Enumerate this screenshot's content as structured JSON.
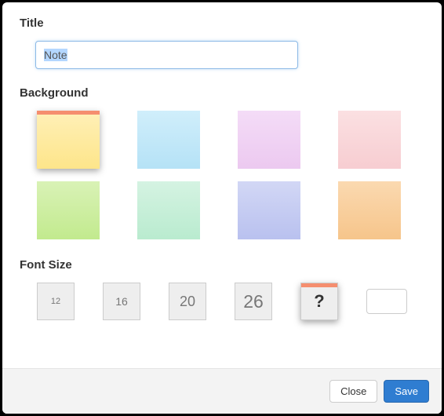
{
  "labels": {
    "title": "Title",
    "background": "Background",
    "fontsize": "Font Size"
  },
  "title_input": {
    "value": "Note"
  },
  "backgrounds": [
    {
      "id": "yellow",
      "selected": true
    },
    {
      "id": "blue",
      "selected": false
    },
    {
      "id": "pink",
      "selected": false
    },
    {
      "id": "rose",
      "selected": false
    },
    {
      "id": "green",
      "selected": false
    },
    {
      "id": "mint",
      "selected": false
    },
    {
      "id": "violet",
      "selected": false
    },
    {
      "id": "orange",
      "selected": false
    }
  ],
  "font_sizes": [
    {
      "label": "12",
      "selected": false
    },
    {
      "label": "16",
      "selected": false
    },
    {
      "label": "20",
      "selected": false
    },
    {
      "label": "26",
      "selected": false
    },
    {
      "label": "?",
      "selected": true
    }
  ],
  "custom_font": {
    "value": ""
  },
  "footer": {
    "close": "Close",
    "save": "Save"
  }
}
